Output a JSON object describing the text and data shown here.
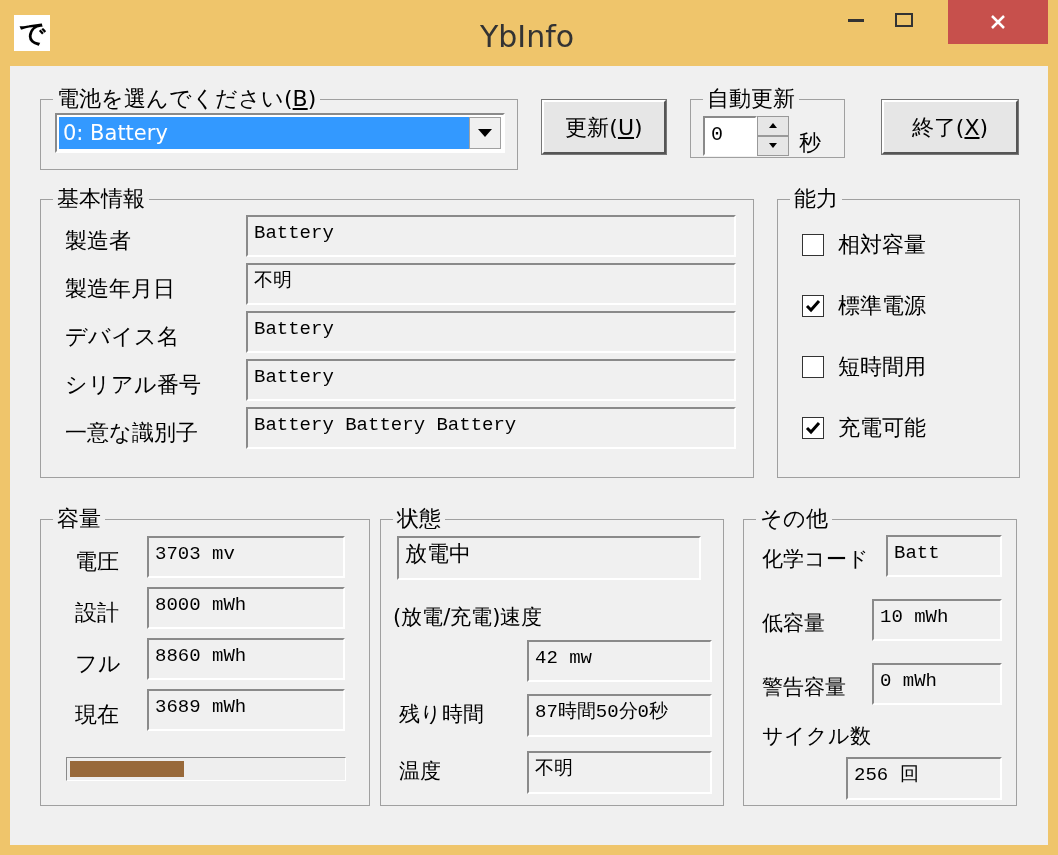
{
  "window": {
    "title": "YbInfo",
    "app_icon": "で"
  },
  "battery_group": {
    "label": {
      "before": "電池を選んでください(",
      "key": "B",
      "after": ")"
    },
    "selected_battery": "0: Battery"
  },
  "refresh_button": {
    "before": "更新(",
    "key": "U",
    "after": ")"
  },
  "auto_update": {
    "title": "自動更新",
    "value": "0",
    "unit": "秒"
  },
  "exit_button": {
    "before": "終了(",
    "key": "X",
    "after": ")"
  },
  "basic_info": {
    "title": "基本情報",
    "rows": [
      {
        "label": "製造者",
        "value": "Battery"
      },
      {
        "label": "製造年月日",
        "value": "不明"
      },
      {
        "label": "デバイス名",
        "value": "Battery"
      },
      {
        "label": "シリアル番号",
        "value": "Battery"
      },
      {
        "label": "一意な識別子",
        "value": "Battery Battery Battery"
      }
    ]
  },
  "capabilities": {
    "title": "能力",
    "items": [
      {
        "label": "相対容量",
        "checked": false
      },
      {
        "label": "標準電源",
        "checked": true
      },
      {
        "label": "短時間用",
        "checked": false
      },
      {
        "label": "充電可能",
        "checked": true
      }
    ]
  },
  "capacity": {
    "title": "容量",
    "rows": [
      {
        "label": "電圧",
        "value": "3703 mv"
      },
      {
        "label": "設計",
        "value": "8000 mWh"
      },
      {
        "label": "フル",
        "value": "8860 mWh"
      },
      {
        "label": "現在",
        "value": "3689 mWh"
      }
    ],
    "level": 0.42
  },
  "status": {
    "title": "状態",
    "state": "放電中",
    "rate_label": "(放電/充電)速度",
    "rate": "42 mw",
    "rows": [
      {
        "label": "残り時間",
        "value": "87時間50分0秒"
      },
      {
        "label": "温度",
        "value": "不明"
      }
    ]
  },
  "other": {
    "title": "その他",
    "rows": [
      {
        "label": "化学コード",
        "value": "Batt"
      },
      {
        "label": "低容量",
        "value": "10 mWh"
      },
      {
        "label": "警告容量",
        "value": "0 mWh"
      }
    ],
    "cycle_label": "サイクル数",
    "cycle_value": "256 回"
  }
}
